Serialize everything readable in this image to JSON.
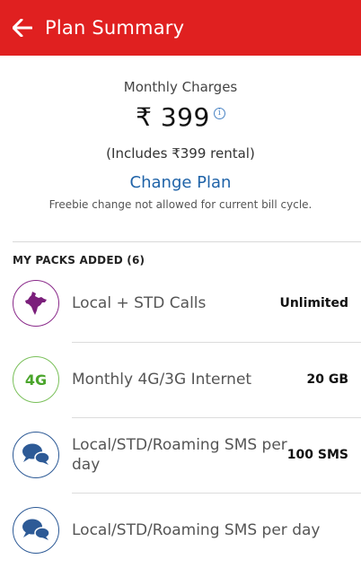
{
  "header": {
    "title": "Plan Summary",
    "back_icon": "arrow-left-icon",
    "background": "#e02020"
  },
  "summary": {
    "monthly_label": "Monthly Charges",
    "amount": "₹ 399",
    "info_icon": "info-icon",
    "rental_note": "(Includes ₹399 rental)",
    "change_plan_label": "Change Plan",
    "freebie_note": "Freebie change not allowed for current bill cycle."
  },
  "packs": {
    "header": "MY PACKS ADDED (6)",
    "items": [
      {
        "icon": "india-map-icon",
        "name": "Local + STD Calls",
        "value": "Unlimited"
      },
      {
        "icon": "4g-icon",
        "icon_text": "4G",
        "name": "Monthly 4G/3G Internet",
        "value": "20 GB"
      },
      {
        "icon": "sms-bubbles-icon",
        "name": "Local/STD/Roaming SMS per day",
        "value": "100 SMS"
      },
      {
        "icon": "sms-bubbles-icon",
        "name": "Local/STD/Roaming SMS per day",
        "value": ""
      }
    ]
  },
  "colors": {
    "accent_red": "#e02020",
    "link_blue": "#1f63a8",
    "india_purple": "#7b1f7b",
    "fourg_green": "#4aa52b",
    "sms_blue": "#2d5a96"
  }
}
